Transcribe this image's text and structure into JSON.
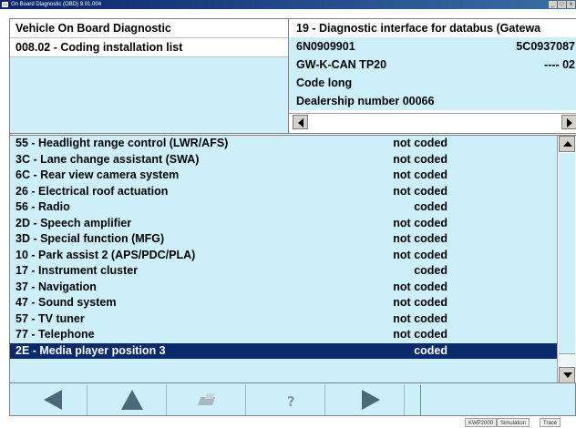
{
  "window": {
    "title": "On Board Diagnostic (OBD) 9.01.004"
  },
  "header": {
    "left": {
      "title": "Vehicle On Board Diagnostic",
      "function": "008.02 - Coding installation list"
    },
    "right": {
      "module": "19 - Diagnostic interface for databus (Gatewa",
      "part_number": "6N0909901",
      "part_number_right": "5C0937087",
      "component": "GW-K-CAN TP20",
      "component_right": "---- 02",
      "coding": "Code long",
      "dealer": "Dealership number 00066"
    }
  },
  "list": {
    "rows": [
      {
        "label": "55 - Headlight range control (LWR/AFS)",
        "status": "not coded"
      },
      {
        "label": "3C - Lane change assistant (SWA)",
        "status": "not coded"
      },
      {
        "label": "6C - Rear view camera system",
        "status": "not coded"
      },
      {
        "label": "26 - Electrical roof actuation",
        "status": "not coded"
      },
      {
        "label": "56 - Radio",
        "status": "coded"
      },
      {
        "label": "2D - Speech amplifier",
        "status": "not coded"
      },
      {
        "label": "3D - Special function (MFG)",
        "status": "not coded"
      },
      {
        "label": "10 - Park assist 2 (APS/PDC/PLA)",
        "status": "not coded"
      },
      {
        "label": "17 - Instrument cluster",
        "status": "coded"
      },
      {
        "label": "37 - Navigation",
        "status": "not coded"
      },
      {
        "label": "47 - Sound system",
        "status": "not coded"
      },
      {
        "label": "57 - TV tuner",
        "status": "not coded"
      },
      {
        "label": "77 - Telephone",
        "status": "not coded"
      },
      {
        "label": "2E - Media player position 3",
        "status": "coded"
      }
    ],
    "selected_index": 13
  },
  "toolbar": {
    "buttons": [
      {
        "name": "back-icon"
      },
      {
        "name": "home-icon"
      },
      {
        "name": "print-icon"
      },
      {
        "name": "help-icon"
      },
      {
        "name": "forward-icon"
      }
    ]
  },
  "statusbar": {
    "items": [
      "KWP2000",
      "Simulation",
      "Trace"
    ]
  },
  "colors": {
    "panel_bg": "#cdeffa",
    "selection_bg": "#0b2a6b",
    "title_bar": "#0a246a"
  }
}
